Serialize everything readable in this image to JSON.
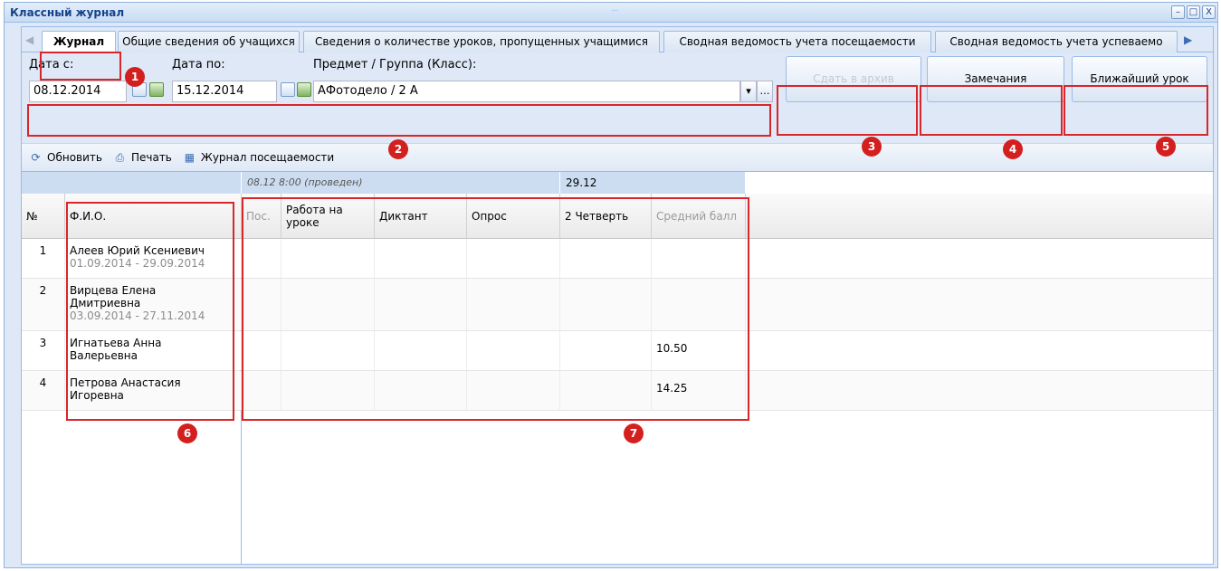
{
  "window": {
    "title": "Классный журнал",
    "grip": "....",
    "controls": [
      "–",
      "□",
      "X"
    ]
  },
  "tabs": [
    {
      "label": "Журнал",
      "active": true
    },
    {
      "label": "Общие сведения об учащихся"
    },
    {
      "label": "Сведения о количестве уроков, пропущенных учащимися"
    },
    {
      "label": "Сводная ведомость учета посещаемости"
    },
    {
      "label": "Сводная ведомость учета успеваемо"
    }
  ],
  "filters": {
    "date_from_label": "Дата с:",
    "date_from": "08.12.2014",
    "date_to_label": "Дата по:",
    "date_to": "15.12.2014",
    "subject_label": "Предмет / Группа (Класс):",
    "subject": "АФотоделo / 2 А",
    "combo_arrow": "▾",
    "combo_more": "…"
  },
  "buttons": {
    "archive": "Сдать в архив",
    "remarks": "Замечания",
    "nearest": "Ближайший урок"
  },
  "toolbar": {
    "refresh": "Обновить",
    "print": "Печать",
    "attendance": "Журнал посещаемости"
  },
  "grid": {
    "groups": {
      "lesson1": "08.12 8:00 (проведен)",
      "lesson2": "29.12"
    },
    "columns": {
      "num": "№",
      "fio": "Ф.И.О.",
      "pos": "Пос.",
      "work": "Работа на уроке",
      "dictation": "Диктант",
      "survey": "Опрос",
      "quarter": "2 Четверть",
      "avg": "Средний балл"
    },
    "rows": [
      {
        "num": "1",
        "name": "Алеев Юрий Ксениевич",
        "period": "01.09.2014 - 29.09.2014",
        "avg": ""
      },
      {
        "num": "2",
        "name": "Вирцева Елена Дмитриевна",
        "period": "03.09.2014 - 27.11.2014",
        "avg": ""
      },
      {
        "num": "3",
        "name": "Игнатьева Анна Валерьевна",
        "period": "",
        "avg": "10.50"
      },
      {
        "num": "4",
        "name": "Петрова Анастасия Игоревна",
        "period": "",
        "avg": "14.25"
      }
    ]
  },
  "annotations": [
    "1",
    "2",
    "3",
    "4",
    "5",
    "6",
    "7"
  ],
  "colors": {
    "annotation": "#d9262a",
    "header": "#dfe8f6",
    "border": "#99bbe8"
  }
}
